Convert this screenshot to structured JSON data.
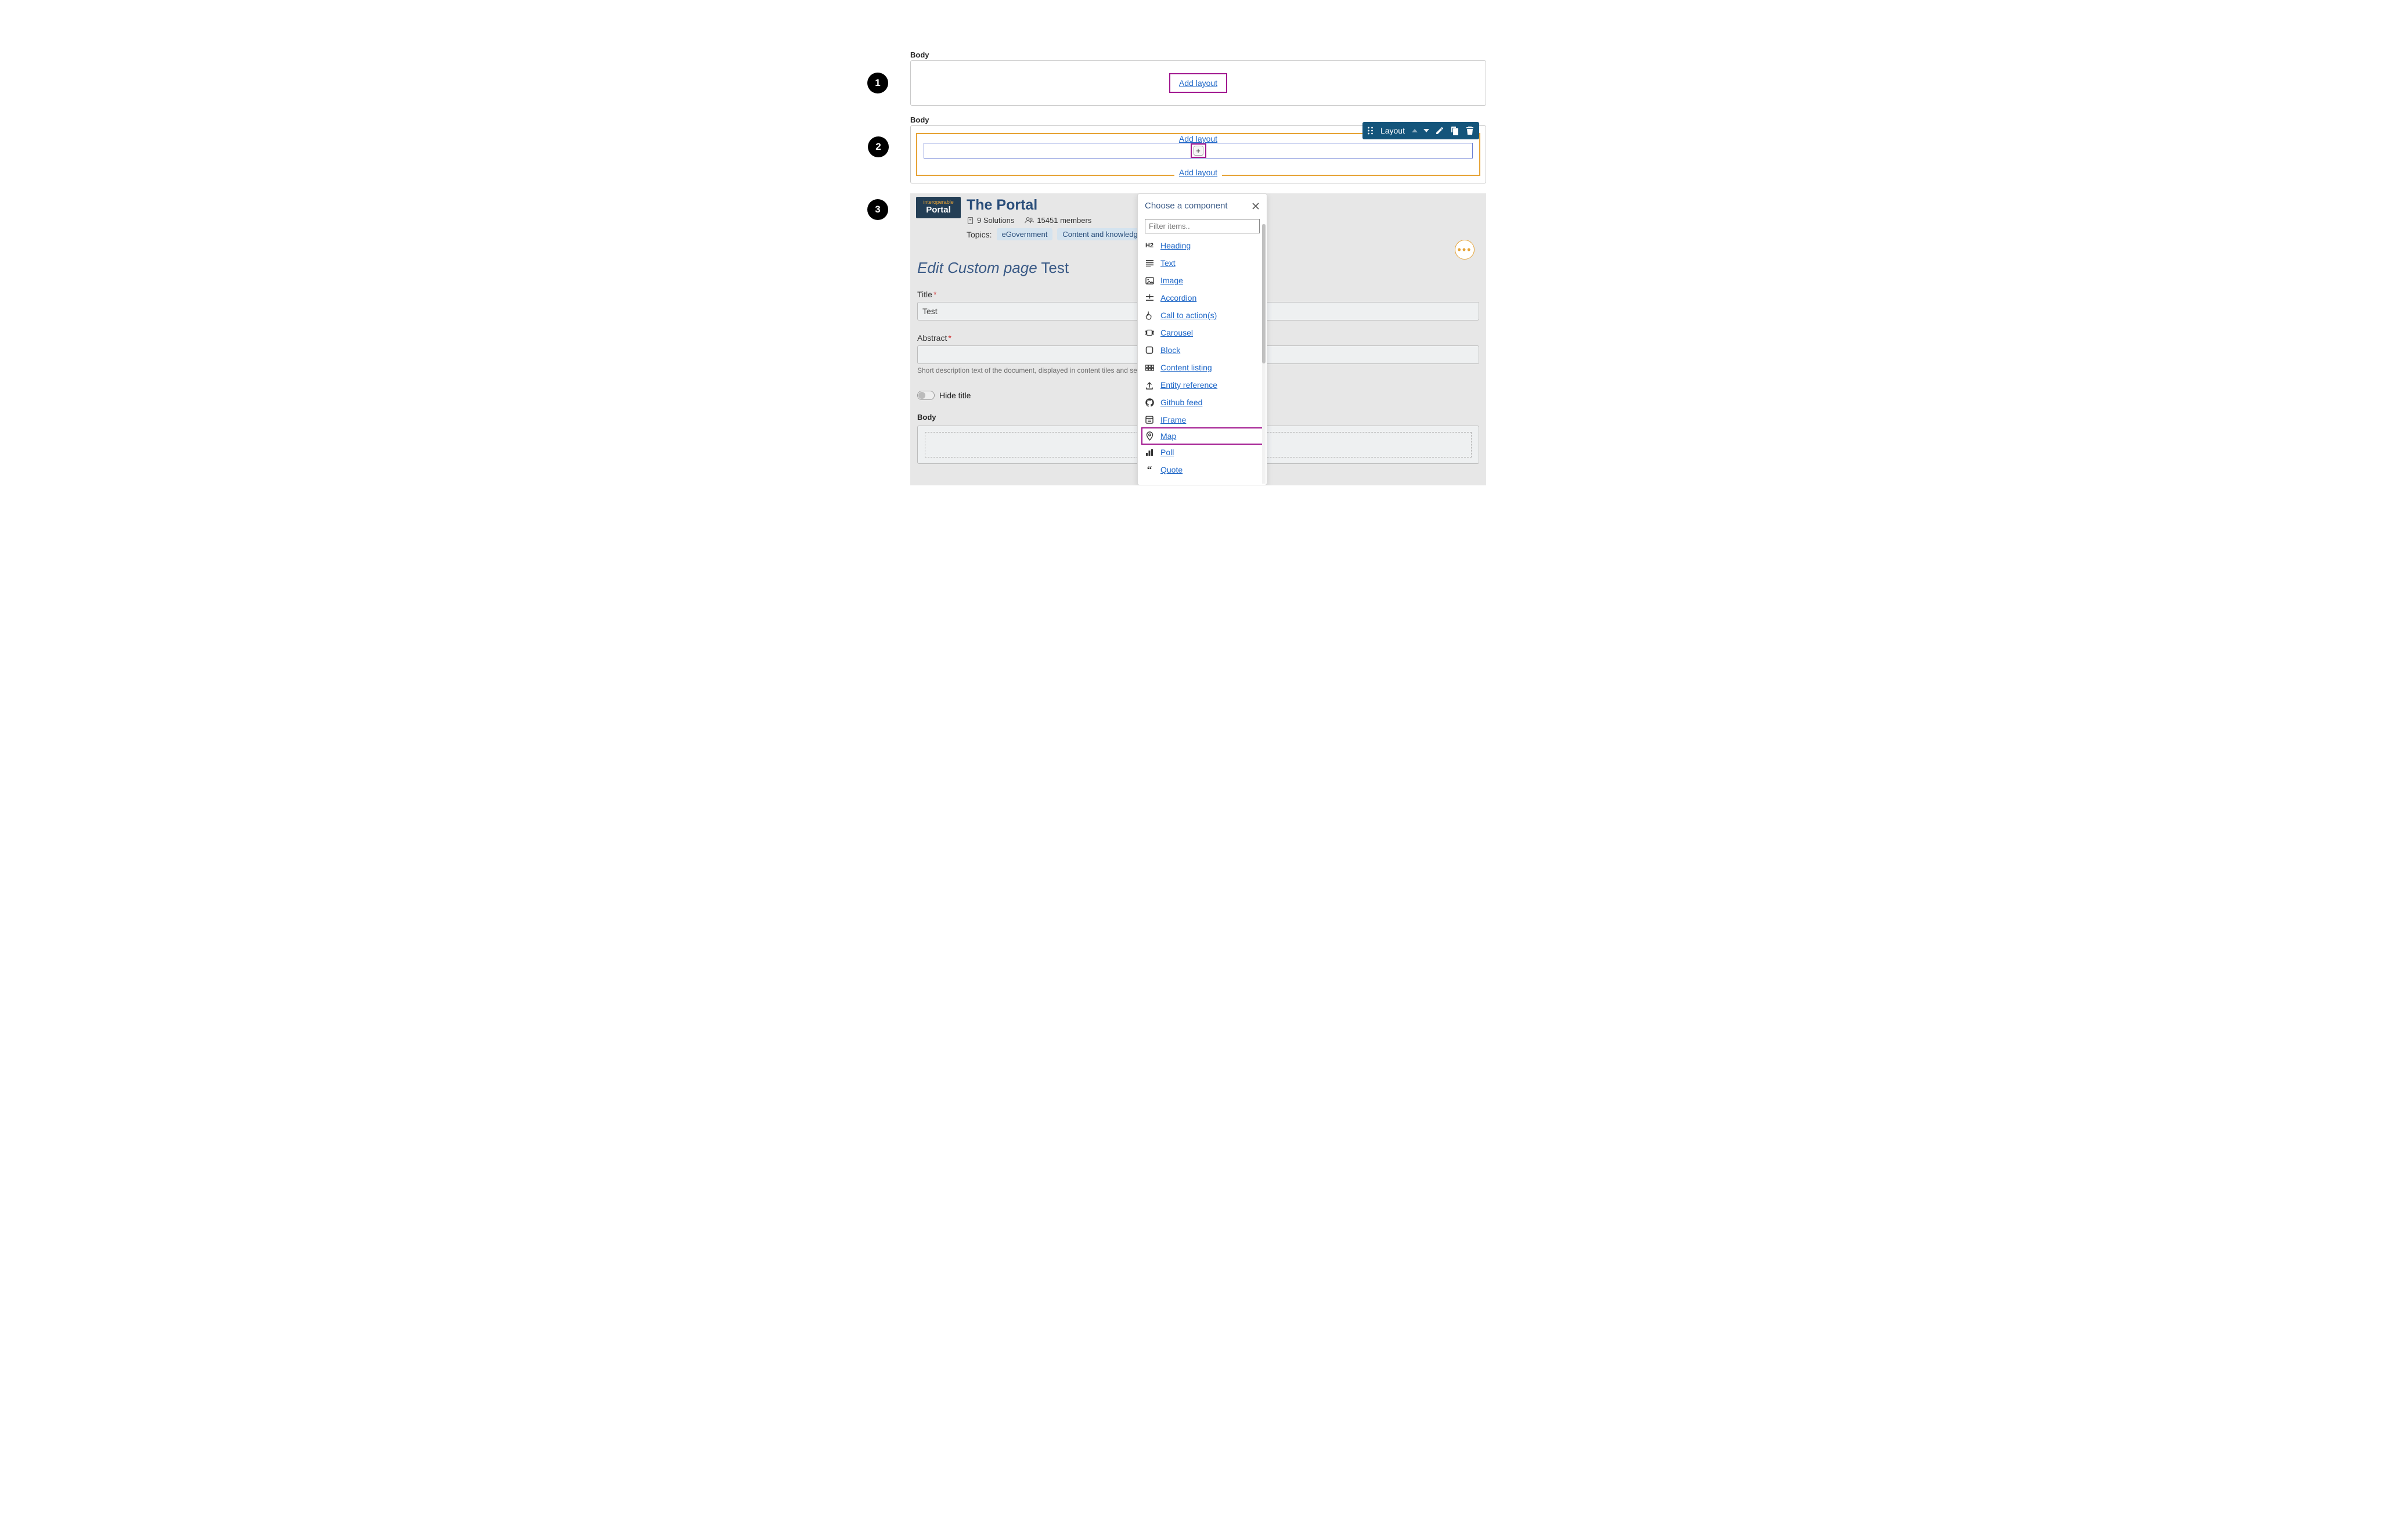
{
  "step1": {
    "body_label": "Body",
    "add_layout": "Add layout",
    "badge": "1"
  },
  "step2": {
    "body_label": "Body",
    "add_layout_top": "Add layout",
    "add_layout_bottom": "Add layout",
    "plus": "+",
    "badge": "2",
    "toolbar_label": "Layout"
  },
  "step3": {
    "badge": "3",
    "logo_line1": "interoperable",
    "logo_line2": "Portal",
    "portal_title": "The Portal",
    "solutions_count": "9 Solutions",
    "members_count": "15451 members",
    "topics_label": "Topics:",
    "topic1": "eGovernment",
    "topic2": "Content and knowledge mana",
    "more_label": "•••",
    "page_title_em": "Edit Custom page",
    "page_title_rest": " Test",
    "title_label": "Title",
    "title_value": "Test",
    "abstract_label": "Abstract",
    "abstract_help": "Short description text of the document, displayed in content tiles and search resul",
    "hide_title_label": "Hide title",
    "body_label": "Body"
  },
  "picker": {
    "heading": "Choose a component",
    "filter_placeholder": "Filter items..",
    "items": [
      {
        "icon": "h2",
        "label": "Heading"
      },
      {
        "icon": "lines",
        "label": "Text"
      },
      {
        "icon": "image",
        "label": "Image"
      },
      {
        "icon": "accordion",
        "label": "Accordion"
      },
      {
        "icon": "pointer",
        "label": "Call to action(s)"
      },
      {
        "icon": "carousel",
        "label": "Carousel"
      },
      {
        "icon": "block",
        "label": "Block"
      },
      {
        "icon": "grid",
        "label": "Content listing"
      },
      {
        "icon": "upload",
        "label": "Entity reference"
      },
      {
        "icon": "github",
        "label": "Github feed"
      },
      {
        "icon": "iframe",
        "label": "IFrame"
      },
      {
        "icon": "pin",
        "label": "Map",
        "highlight": true
      },
      {
        "icon": "poll",
        "label": "Poll"
      },
      {
        "icon": "quote",
        "label": "Quote"
      }
    ]
  }
}
